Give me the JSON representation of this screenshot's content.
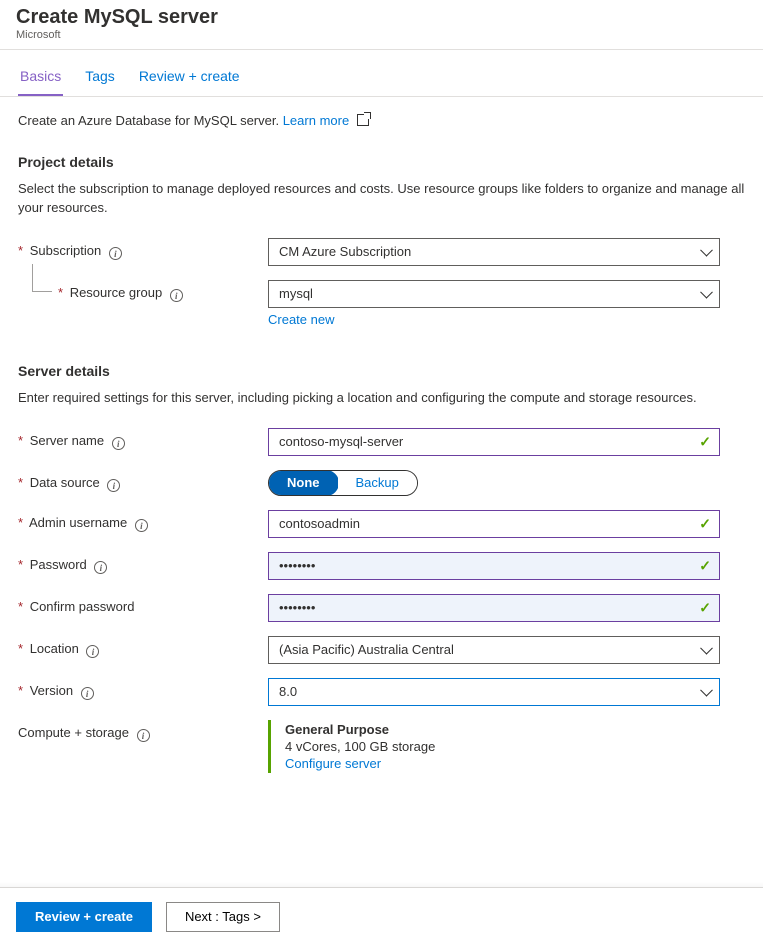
{
  "header": {
    "title": "Create MySQL server",
    "subtitle": "Microsoft"
  },
  "tabs": {
    "basics": "Basics",
    "tags": "Tags",
    "review": "Review + create"
  },
  "intro": {
    "text": "Create an Azure Database for MySQL server. ",
    "learn_more": "Learn more"
  },
  "project_details": {
    "heading": "Project details",
    "description": "Select the subscription to manage deployed resources and costs. Use resource groups like folders to organize and manage all your resources.",
    "subscription_label": "Subscription",
    "subscription_value": "CM Azure Subscription",
    "resource_group_label": "Resource group",
    "resource_group_value": "mysql",
    "create_new": "Create new"
  },
  "server_details": {
    "heading": "Server details",
    "description": "Enter required settings for this server, including picking a location and configuring the compute and storage resources.",
    "server_name_label": "Server name",
    "server_name_value": "contoso-mysql-server",
    "data_source_label": "Data source",
    "data_source_none": "None",
    "data_source_backup": "Backup",
    "admin_label": "Admin username",
    "admin_value": "contosoadmin",
    "password_label": "Password",
    "password_value": "••••••••",
    "confirm_label": "Confirm password",
    "confirm_value": "••••••••",
    "location_label": "Location",
    "location_value": "(Asia Pacific) Australia Central",
    "version_label": "Version",
    "version_value": "8.0",
    "compute_label": "Compute + storage",
    "compute_title": "General Purpose",
    "compute_spec": "4 vCores, 100 GB storage",
    "configure_server": "Configure server"
  },
  "footer": {
    "review": "Review + create",
    "next": "Next : Tags >"
  }
}
